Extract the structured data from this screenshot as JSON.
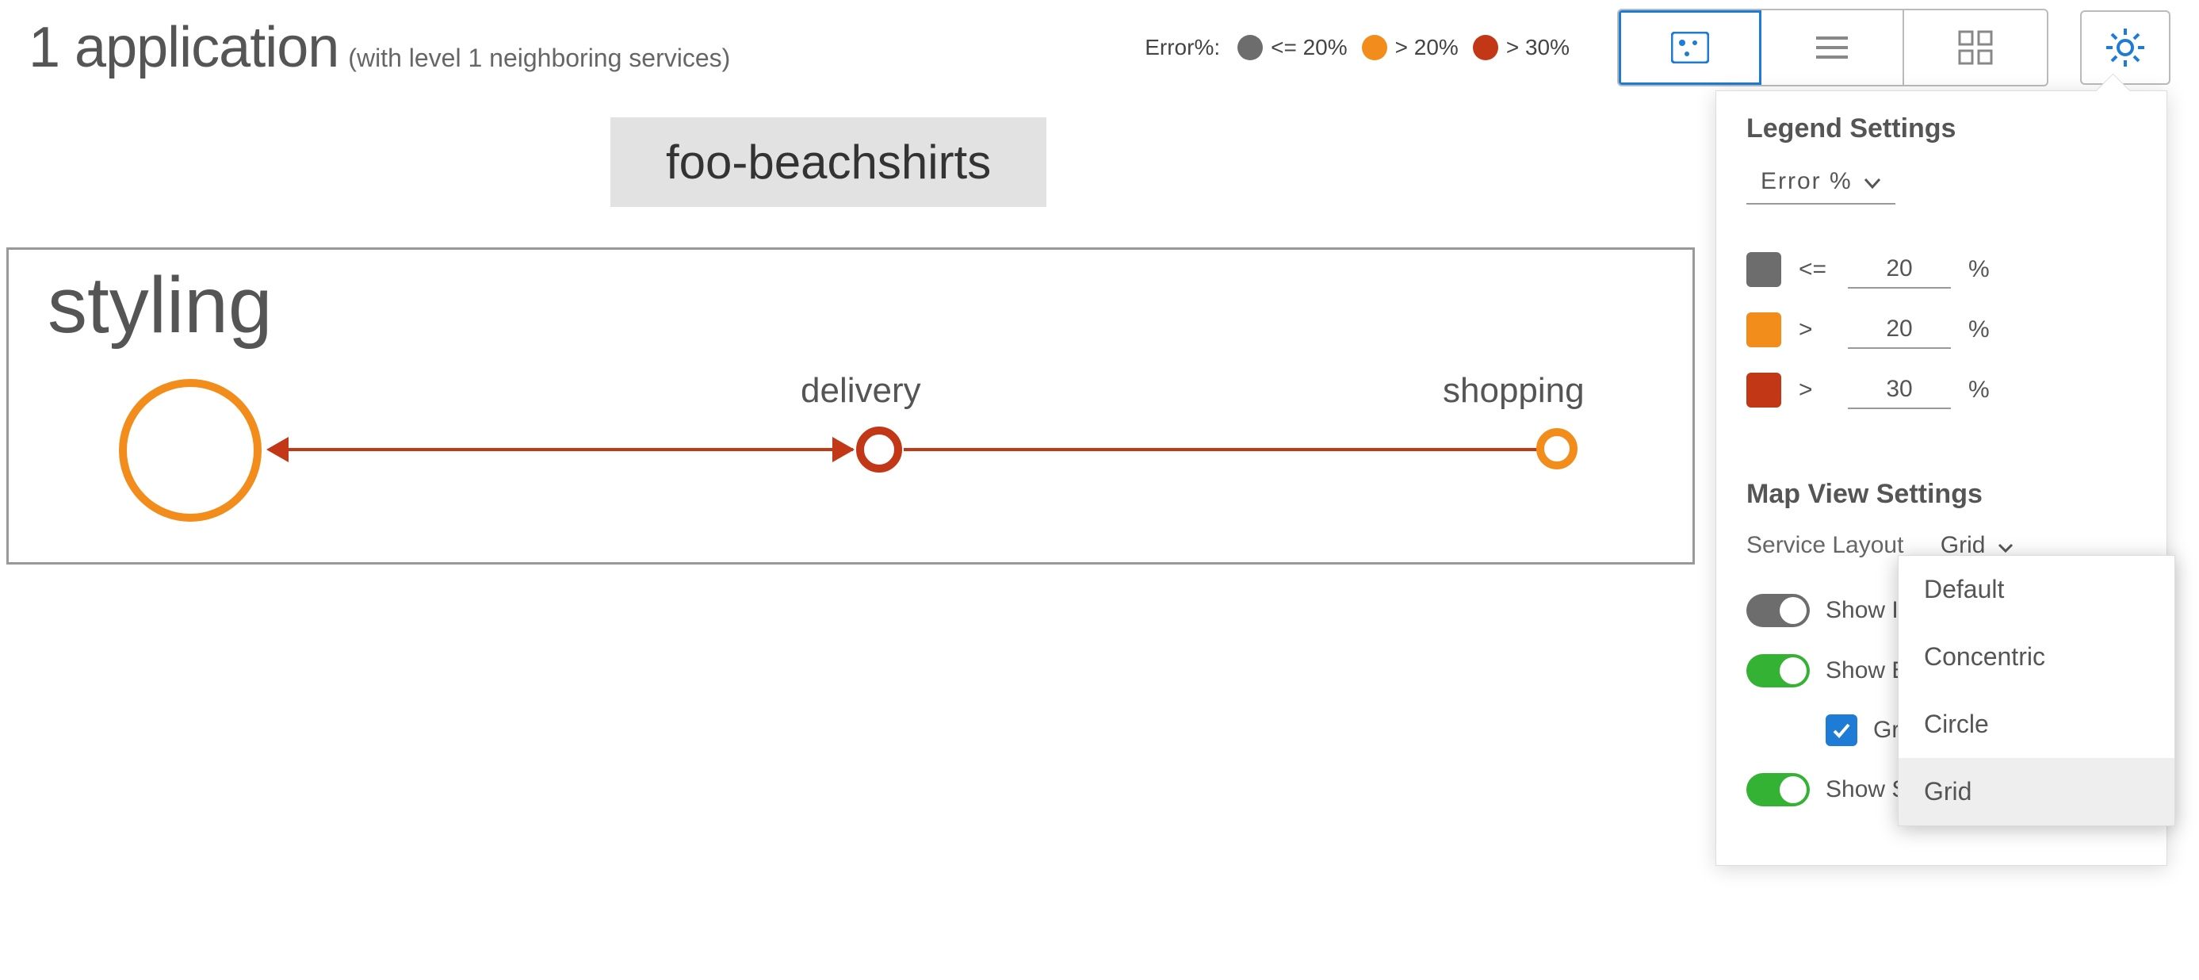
{
  "header": {
    "title": "1 application",
    "subtitle": "(with level 1 neighboring services)"
  },
  "legend": {
    "label": "Error%:",
    "items": [
      {
        "color": "#6d6d6d",
        "text": "<= 20%"
      },
      {
        "color": "#f28c1a",
        "text": "> 20%"
      },
      {
        "color": "#c23716",
        "text": "> 30%"
      }
    ]
  },
  "app_chip": "foo-beachshirts",
  "services": {
    "styling": {
      "label": "styling"
    },
    "delivery": {
      "label": "delivery"
    },
    "shopping": {
      "label": "shopping"
    }
  },
  "settings": {
    "legend_title": "Legend Settings",
    "metric": "Error %",
    "levels": [
      {
        "color": "#6d6d6d",
        "op": "<=",
        "value": "20",
        "unit": "%"
      },
      {
        "color": "#f28c1a",
        "op": ">",
        "value": "20",
        "unit": "%"
      },
      {
        "color": "#c23716",
        "op": ">",
        "value": "30",
        "unit": "%"
      }
    ],
    "map_title": "Map View Settings",
    "layout_label": "Service Layout",
    "layout_value": "Grid",
    "layout_options": [
      "Default",
      "Concentric",
      "Circle",
      "Grid"
    ],
    "toggles": {
      "isolated": {
        "label": "Show Isol",
        "on": false
      },
      "external": {
        "label": "Show Ext",
        "on": true
      },
      "group": {
        "label": "Group",
        "checked": true
      },
      "service": {
        "label": "Show Ser",
        "on": true
      }
    }
  }
}
